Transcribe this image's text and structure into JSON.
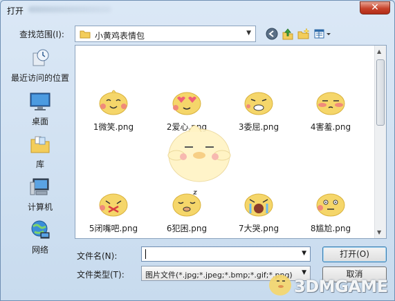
{
  "window": {
    "title": "打开",
    "close": "✕"
  },
  "toolbar": {
    "look_in_label": "查找范围(I):",
    "look_in_value": "小黄鸡表情包",
    "back_icon": "back-arrow-icon",
    "up_icon": "up-folder-icon",
    "new_folder_icon": "new-folder-icon",
    "view_icon": "view-menu-icon"
  },
  "places": [
    {
      "label": "最近访问的位置",
      "icon": "recent-places-icon"
    },
    {
      "label": "桌面",
      "icon": "desktop-icon"
    },
    {
      "label": "库",
      "icon": "libraries-icon"
    },
    {
      "label": "计算机",
      "icon": "computer-icon"
    },
    {
      "label": "网络",
      "icon": "network-icon"
    }
  ],
  "files": [
    {
      "name": "1微笑.png",
      "face": "smile"
    },
    {
      "name": "2爱心.png",
      "face": "love"
    },
    {
      "name": "3委屈.png",
      "face": "sad"
    },
    {
      "name": "4害羞.png",
      "face": "shy"
    },
    {
      "name": "5闭嘴吧.png",
      "face": "shutup"
    },
    {
      "name": "6犯困.png",
      "face": "sleepy"
    },
    {
      "name": "7大哭.png",
      "face": "cry"
    },
    {
      "name": "8尴尬.png",
      "face": "awkward"
    }
  ],
  "form": {
    "filename_label": "文件名(N):",
    "filename_value": "",
    "filetype_label": "文件类型(T):",
    "filetype_value": "图片文件(*.jpg;*.jpeg;*.bmp;*.gif;*.png)",
    "open_button": "打开(O)",
    "cancel_button": "取消"
  },
  "watermark": {
    "text": "3DMGAME"
  },
  "colors": {
    "accent": "#3c7fb1",
    "chick": "#f5d66a",
    "close": "#c7432b"
  }
}
